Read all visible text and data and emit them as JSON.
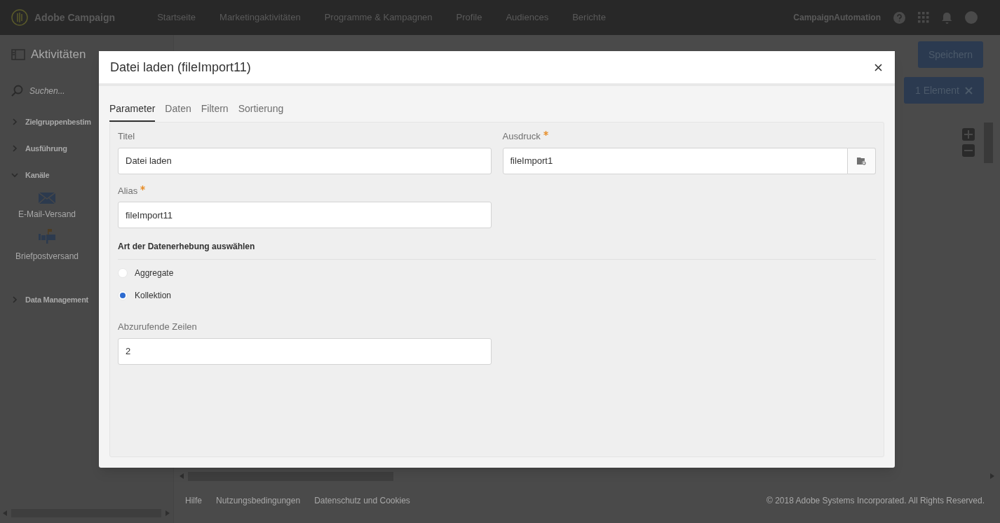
{
  "topbar": {
    "brand": "Adobe Campaign",
    "nav": [
      "Startseite",
      "Marketingaktivitäten",
      "Programme & Kampagnen",
      "Profile",
      "Audiences",
      "Berichte"
    ],
    "user": "CampaignAutomation"
  },
  "sidebar": {
    "title": "Aktivitäten",
    "search_placeholder": "Suchen...",
    "groups": [
      {
        "label": "Zielgruppenbestim",
        "expanded": false
      },
      {
        "label": "Ausführung",
        "expanded": false
      },
      {
        "label": "Kanäle",
        "expanded": true,
        "items": [
          {
            "label": "E-Mail-Versand",
            "kind": "email"
          },
          {
            "label": "Briefpostversand",
            "kind": "mail"
          }
        ]
      },
      {
        "label": "Data Management",
        "expanded": false
      }
    ]
  },
  "toolbar": {
    "save": "Speichern",
    "selection": "1 Element"
  },
  "footer": {
    "links": [
      "Hilfe",
      "Nutzungsbedingungen",
      "Datenschutz und Cookies"
    ],
    "copyright": "© 2018 Adobe Systems Incorporated. All Rights Reserved."
  },
  "dialog": {
    "title": "Datei laden (fileImport11)",
    "tabs": [
      {
        "label": "Parameter",
        "selected": true
      },
      {
        "label": "Daten",
        "selected": false
      },
      {
        "label": "Filtern",
        "selected": false
      },
      {
        "label": "Sortierung",
        "selected": false
      }
    ],
    "fields": {
      "title": {
        "label": "Titel",
        "required": false,
        "value": "Datei laden"
      },
      "expression": {
        "label": "Ausdruck",
        "required": true,
        "value": "fileImport1"
      },
      "alias": {
        "label": "Alias",
        "required": true,
        "value": "fileImport11"
      }
    },
    "section": "Art der Datenerhebung auswählen",
    "options": [
      {
        "label": "Aggregate",
        "selected": false
      },
      {
        "label": "Kollektion",
        "selected": true
      }
    ],
    "rows": {
      "label": "Abzurufende Zeilen",
      "required": false,
      "value": "2"
    }
  }
}
